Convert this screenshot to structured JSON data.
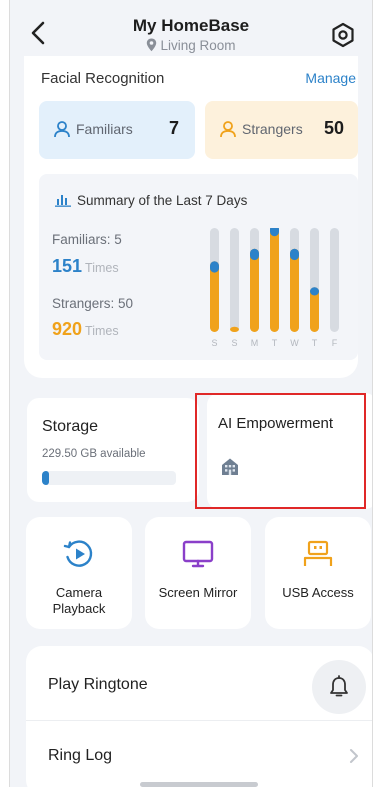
{
  "header": {
    "title": "My HomeBase",
    "location": "Living Room"
  },
  "facial_recognition": {
    "title": "Facial Recognition",
    "manage_label": "Manage",
    "familiars_label": "Familiars",
    "familiars_count": "7",
    "strangers_label": "Strangers",
    "strangers_count": "50"
  },
  "summary": {
    "title": "Summary of the Last 7 Days",
    "familiars_label": "Familiars: 5",
    "familiars_times_value": "151",
    "strangers_label": "Strangers: 50",
    "strangers_times_value": "920",
    "times_unit": "Times",
    "accent_familiar": "#2c82c9",
    "accent_stranger": "#f0a21b"
  },
  "chart_data": {
    "type": "bar",
    "categories": [
      "S",
      "S",
      "M",
      "T",
      "W",
      "T",
      "F"
    ],
    "series": [
      {
        "values": [
          0.6,
          0.05,
          0.72,
          0.95,
          0.72,
          0.38,
          0
        ]
      },
      {
        "values": [
          0.08,
          0,
          0.08,
          0.08,
          0.08,
          0.05,
          0
        ]
      }
    ],
    "ylim": [
      0,
      1
    ],
    "colors": [
      "#f0a21b",
      "#2c82c9"
    ]
  },
  "storage": {
    "title": "Storage",
    "available": "229.50 GB available",
    "used_fraction": 0.05
  },
  "ai": {
    "title": "AI Empowerment",
    "icon": "house-icon"
  },
  "tiles": [
    {
      "label": "Camera Playback",
      "icon": "camera-playback-icon",
      "color": "#2c82c9"
    },
    {
      "label": "Screen Mirror",
      "icon": "screen-mirror-icon",
      "color": "#8a3fc9"
    },
    {
      "label": "USB Access",
      "icon": "usb-icon",
      "color": "#f0a21b"
    }
  ],
  "list": {
    "play_ringtone": "Play Ringtone",
    "ring_log": "Ring Log"
  }
}
